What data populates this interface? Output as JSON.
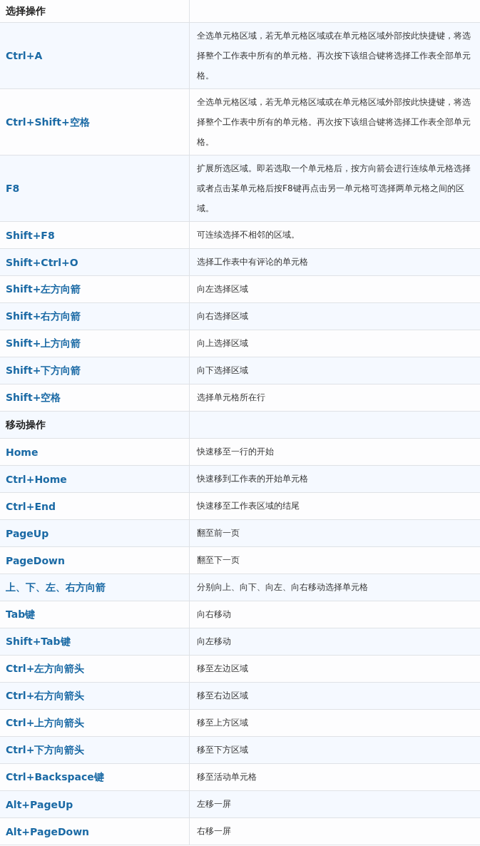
{
  "rows": [
    {
      "kind": "section",
      "label": "选择操作"
    },
    {
      "kind": "shortcut",
      "keys": "Ctrl+A",
      "description": "全选单元格区域，若无单元格区域或在单元格区域外部按此快捷键，将选择整个工作表中所有的单元格。再次按下该组合键将选择工作表全部单元格。"
    },
    {
      "kind": "shortcut",
      "keys": "Ctrl+Shift+空格",
      "description": "全选单元格区域，若无单元格区域或在单元格区域外部按此快捷键，将选择整个工作表中所有的单元格。再次按下该组合键将选择工作表全部单元格。"
    },
    {
      "kind": "shortcut",
      "keys": "F8",
      "description": "扩展所选区域。即若选取一个单元格后，按方向箭会进行连续单元格选择或者点击某单元格后按F8键再点击另一单元格可选择两单元格之间的区域。"
    },
    {
      "kind": "shortcut",
      "keys": "Shift+F8",
      "description": "可连续选择不相邻的区域。"
    },
    {
      "kind": "shortcut",
      "keys": "Shift+Ctrl+O",
      "description": "选择工作表中有评论的单元格"
    },
    {
      "kind": "shortcut",
      "keys": "Shift+左方向箭",
      "description": "向左选择区域"
    },
    {
      "kind": "shortcut",
      "keys": "Shift+右方向箭",
      "description": "向右选择区域"
    },
    {
      "kind": "shortcut",
      "keys": "Shift+上方向箭",
      "description": "向上选择区域"
    },
    {
      "kind": "shortcut",
      "keys": "Shift+下方向箭",
      "description": "向下选择区域"
    },
    {
      "kind": "shortcut",
      "keys": "Shift+空格",
      "description": "选择单元格所在行"
    },
    {
      "kind": "section",
      "label": "移动操作"
    },
    {
      "kind": "shortcut",
      "keys": "Home",
      "description": "快速移至一行的开始"
    },
    {
      "kind": "shortcut",
      "keys": "Ctrl+Home",
      "description": "快速移到工作表的开始单元格"
    },
    {
      "kind": "shortcut",
      "keys": "Ctrl+End",
      "description": "快速移至工作表区域的结尾"
    },
    {
      "kind": "shortcut",
      "keys": "PageUp",
      "description": "翻至前一页"
    },
    {
      "kind": "shortcut",
      "keys": "PageDown",
      "description": "翻至下一页"
    },
    {
      "kind": "shortcut",
      "keys": "上、下、左、右方向箭",
      "description": "分别向上、向下、向左、向右移动选择单元格"
    },
    {
      "kind": "shortcut",
      "keys": "Tab键",
      "description": "向右移动"
    },
    {
      "kind": "shortcut",
      "keys": "Shift+Tab键",
      "description": "向左移动"
    },
    {
      "kind": "shortcut",
      "keys": "Ctrl+左方向箭头",
      "description": "移至左边区域"
    },
    {
      "kind": "shortcut",
      "keys": "Ctrl+右方向箭头",
      "description": "移至右边区域"
    },
    {
      "kind": "shortcut",
      "keys": "Ctrl+上方向箭头",
      "description": "移至上方区域"
    },
    {
      "kind": "shortcut",
      "keys": "Ctrl+下方向箭头",
      "description": "移至下方区域"
    },
    {
      "kind": "shortcut",
      "keys": "Ctrl+Backspace键",
      "description": "移至活动单元格"
    },
    {
      "kind": "shortcut",
      "keys": "Alt+PageUp",
      "description": "左移一屏"
    },
    {
      "kind": "shortcut",
      "keys": "Alt+PageDown",
      "description": "右移一屏"
    }
  ]
}
